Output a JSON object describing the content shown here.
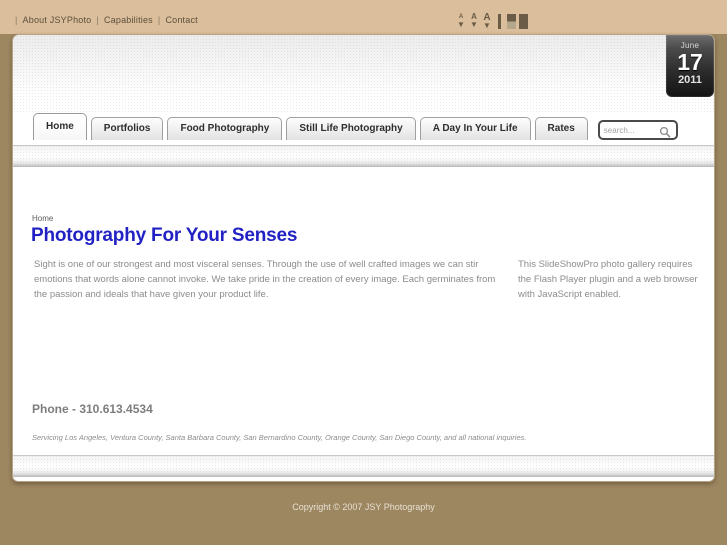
{
  "topbar": {
    "links": [
      "About JSYPhoto",
      "Capabilities",
      "Contact"
    ],
    "separator": "|",
    "tools": {
      "decrease_font_label": "A",
      "reset_font_label": "A",
      "increase_font_label": "A",
      "arrow_glyph": "▼",
      "icons": [
        "font-decrease-icon",
        "font-reset-icon",
        "font-increase-icon",
        "divider-icon",
        "contrast-switch-icon",
        "theme-switch-icon"
      ]
    },
    "background_color": "#dbbe9b"
  },
  "date_badge": {
    "month": "June",
    "day": "17",
    "year": "2011"
  },
  "nav": {
    "tabs": [
      {
        "label": "Home",
        "active": true
      },
      {
        "label": "Portfolios",
        "active": false
      },
      {
        "label": "Food Photography",
        "active": false
      },
      {
        "label": "Still Life Photography",
        "active": false
      },
      {
        "label": "A Day In Your Life",
        "active": false
      },
      {
        "label": "Rates",
        "active": false
      }
    ]
  },
  "search": {
    "placeholder": "search...",
    "value": "",
    "icon": "search-icon"
  },
  "main": {
    "breadcrumb": "Home",
    "title": "Photography For Your Senses",
    "title_color": "#2222c4",
    "body": "Sight is one of our strongest and most visceral senses. Through the use of well crafted images we can stir emotions that words alone cannot invoke. We take pride in the creation of every image. Each germinates from the passion and ideals that have given your product life.",
    "gallery_notice": "This SlideShowPro photo gallery requires the Flash Player plugin and a web browser with JavaScript enabled.",
    "phone": "Phone - 310.613.4534",
    "servicing": "Servicing Los Angeles, Ventura County, Santa Barbara County, San Bernardino County, Orange County, San Diego County, and all national inquiries."
  },
  "footer": {
    "copyright": "Copyright © 2007 JSY Photography"
  },
  "theme": {
    "page_background": "#9d8761",
    "panel_background": "#ffffff",
    "top_band": "#dbbe9b"
  }
}
